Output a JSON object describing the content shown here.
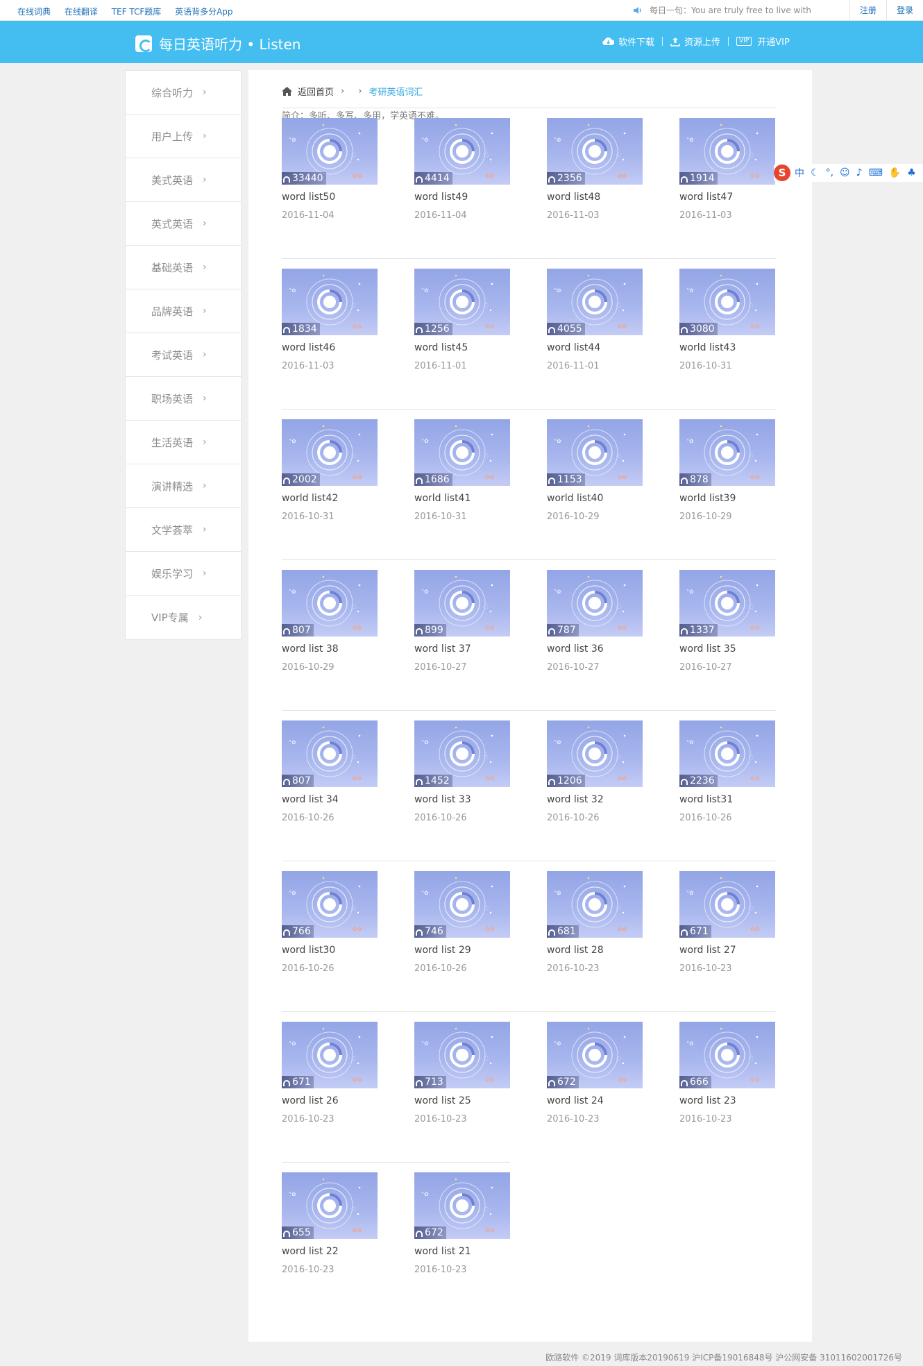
{
  "topbar": {
    "links": [
      "在线词典",
      "在线翻译",
      "TEF TCF题库",
      "英语背多分App"
    ],
    "daily": "每日一句：You are truly free to live with",
    "register": "注册",
    "login": "登录"
  },
  "header": {
    "logo_text": "每日英语听力 • Listen",
    "nav": [
      "软件下载",
      "资源上传",
      "开通VIP"
    ],
    "vip_badge": "VIP"
  },
  "sidebar": {
    "items": [
      "综合听力",
      "用户上传",
      "美式英语",
      "英式英语",
      "基础英语",
      "品牌英语",
      "考试英语",
      "职场英语",
      "生活英语",
      "演讲精选",
      "文学荟萃",
      "娱乐学习",
      "VIP专属"
    ]
  },
  "breadcrumb": {
    "home": "返回首页",
    "current": "考研英语词汇"
  },
  "intro": "简介：多听、多写、多用，学英语不难。",
  "items": [
    {
      "plays": "33440",
      "title": "word list50",
      "date": "2016-11-04"
    },
    {
      "plays": "4414",
      "title": "word list49",
      "date": "2016-11-04"
    },
    {
      "plays": "2356",
      "title": "word list48",
      "date": "2016-11-03"
    },
    {
      "plays": "1914",
      "title": "word list47",
      "date": "2016-11-03"
    },
    {
      "plays": "1834",
      "title": "word list46",
      "date": "2016-11-03"
    },
    {
      "plays": "1256",
      "title": "word list45",
      "date": "2016-11-01"
    },
    {
      "plays": "4055",
      "title": "word list44",
      "date": "2016-11-01"
    },
    {
      "plays": "3080",
      "title": "world list43",
      "date": "2016-10-31"
    },
    {
      "plays": "2002",
      "title": "world list42",
      "date": "2016-10-31"
    },
    {
      "plays": "1686",
      "title": "world list41",
      "date": "2016-10-31"
    },
    {
      "plays": "1153",
      "title": "world list40",
      "date": "2016-10-29"
    },
    {
      "plays": "878",
      "title": "world list39",
      "date": "2016-10-29"
    },
    {
      "plays": "807",
      "title": "word list 38",
      "date": "2016-10-29"
    },
    {
      "plays": "899",
      "title": "word list 37",
      "date": "2016-10-27"
    },
    {
      "plays": "787",
      "title": "word list 36",
      "date": "2016-10-27"
    },
    {
      "plays": "1337",
      "title": "word list 35",
      "date": "2016-10-27"
    },
    {
      "plays": "807",
      "title": "word list 34",
      "date": "2016-10-26"
    },
    {
      "plays": "1452",
      "title": "word list 33",
      "date": "2016-10-26"
    },
    {
      "plays": "1206",
      "title": "word list 32",
      "date": "2016-10-26"
    },
    {
      "plays": "2236",
      "title": "word list31",
      "date": "2016-10-26"
    },
    {
      "plays": "766",
      "title": "word list30",
      "date": "2016-10-26"
    },
    {
      "plays": "746",
      "title": "word list 29",
      "date": "2016-10-26"
    },
    {
      "plays": "681",
      "title": "word list 28",
      "date": "2016-10-23"
    },
    {
      "plays": "671",
      "title": "word list 27",
      "date": "2016-10-23"
    },
    {
      "plays": "671",
      "title": "word list 26",
      "date": "2016-10-23"
    },
    {
      "plays": "713",
      "title": "word list 25",
      "date": "2016-10-23"
    },
    {
      "plays": "672",
      "title": "word list 24",
      "date": "2016-10-23"
    },
    {
      "plays": "666",
      "title": "word list 23",
      "date": "2016-10-23"
    },
    {
      "plays": "655",
      "title": "word list 22",
      "date": "2016-10-23"
    },
    {
      "plays": "672",
      "title": "word list 21",
      "date": "2016-10-23"
    }
  ],
  "ime": {
    "logo": "S",
    "mode": "中"
  },
  "footer": "欧路软件 ©2019 词库版本20190619 沪ICP备19016848号 沪公网安备 31011602001726号",
  "colors": {
    "header_bg": "#44bdf1",
    "link": "#1e6fb9",
    "active": "#36a9e1"
  }
}
